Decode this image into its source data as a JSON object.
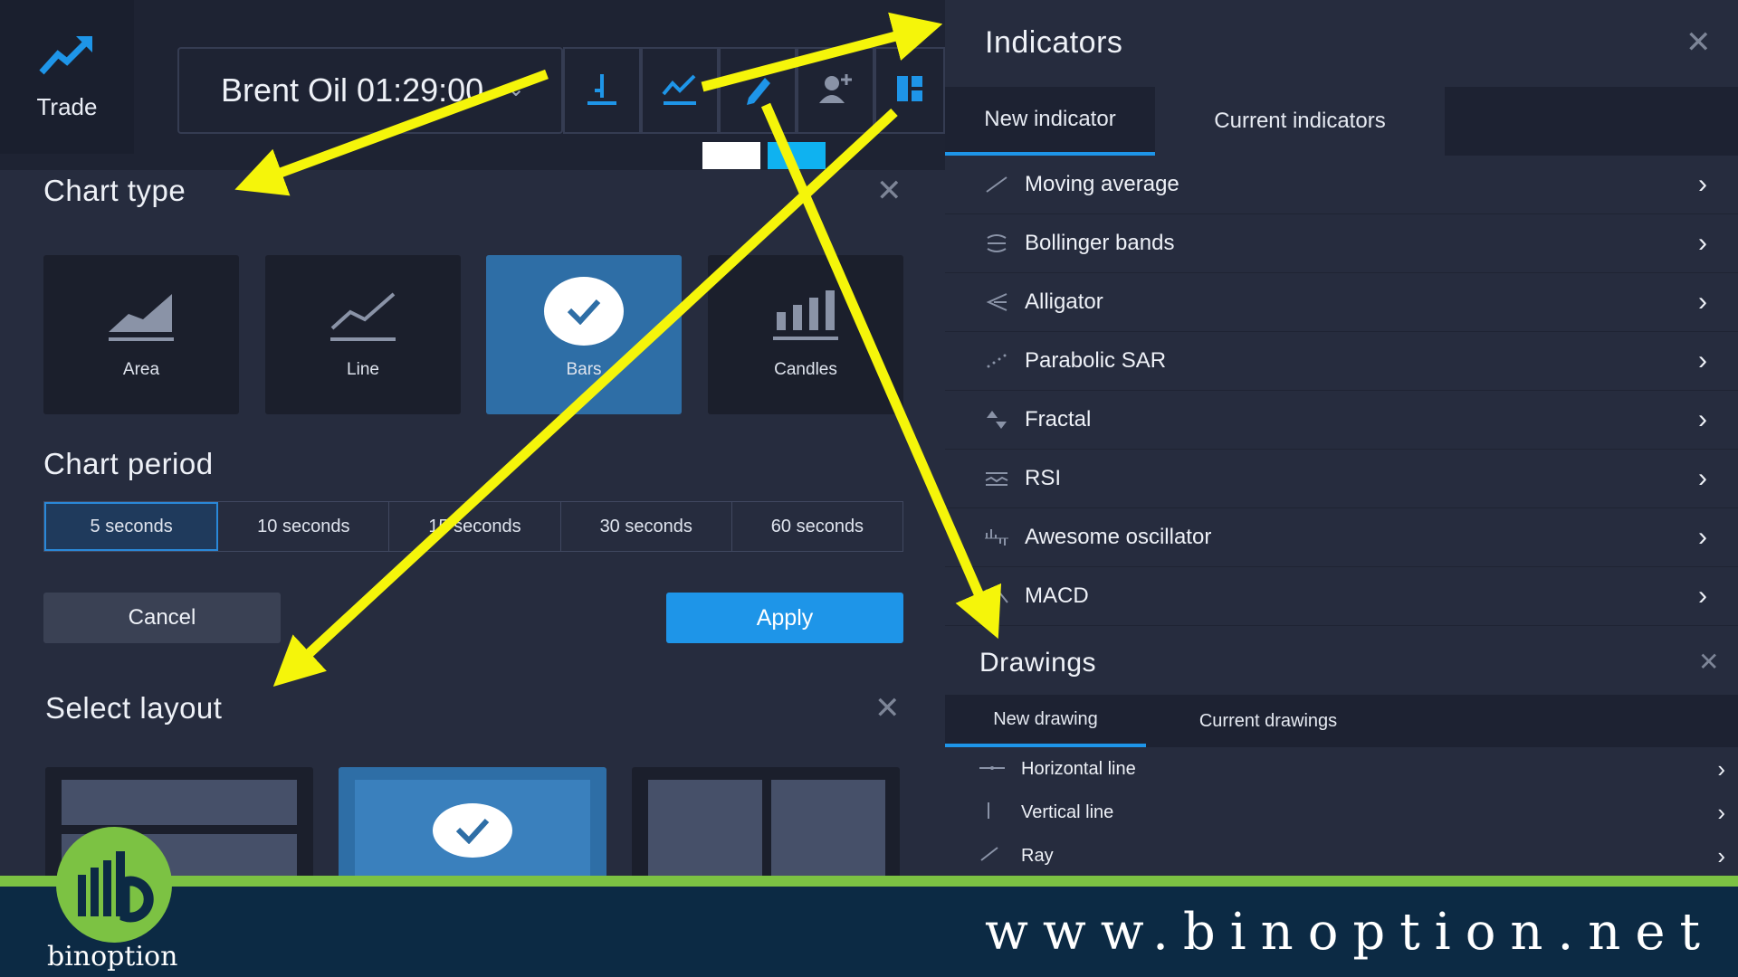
{
  "topbar": {
    "trade_label": "Trade",
    "asset": "Brent Oil 01:29:00"
  },
  "chart_type": {
    "title": "Chart type",
    "types": [
      {
        "label": "Area",
        "icon": "area-chart-icon"
      },
      {
        "label": "Line",
        "icon": "line-chart-icon"
      },
      {
        "label": "Bars",
        "icon": "bars-chart-icon",
        "selected": true
      },
      {
        "label": "Candles",
        "icon": "candles-chart-icon"
      }
    ]
  },
  "chart_period": {
    "title": "Chart period",
    "options": [
      "5 seconds",
      "10 seconds",
      "15 seconds",
      "30 seconds",
      "60 seconds"
    ],
    "selected": "5 seconds"
  },
  "actions": {
    "cancel": "Cancel",
    "apply": "Apply"
  },
  "select_layout": {
    "title": "Select layout"
  },
  "indicators": {
    "title": "Indicators",
    "tabs": [
      "New indicator",
      "Current indicators"
    ],
    "items": [
      {
        "label": "Moving average",
        "icon": "slash-icon"
      },
      {
        "label": "Bollinger bands",
        "icon": "bands-icon"
      },
      {
        "label": "Alligator",
        "icon": "alligator-icon"
      },
      {
        "label": "Parabolic SAR",
        "icon": "dots-icon"
      },
      {
        "label": "Fractal",
        "icon": "fractal-icon"
      },
      {
        "label": "RSI",
        "icon": "rsi-icon"
      },
      {
        "label": "Awesome oscillator",
        "icon": "oscillator-icon"
      },
      {
        "label": "MACD",
        "icon": "macd-icon"
      }
    ]
  },
  "drawings": {
    "title": "Drawings",
    "tabs": [
      "New drawing",
      "Current drawings"
    ],
    "items": [
      {
        "label": "Horizontal line",
        "icon": "horizontal-line-icon"
      },
      {
        "label": "Vertical line",
        "icon": "vertical-line-icon"
      },
      {
        "label": "Ray",
        "icon": "ray-icon"
      }
    ]
  },
  "footer": {
    "brand": "binoption",
    "url": "www.binoption.net"
  },
  "colors": {
    "accent": "#1e95e8",
    "selected_card": "#2e6ea6",
    "annotation_arrow": "#f5f50a",
    "brand_green": "#7cc243",
    "footer_navy": "#0c2a44"
  }
}
